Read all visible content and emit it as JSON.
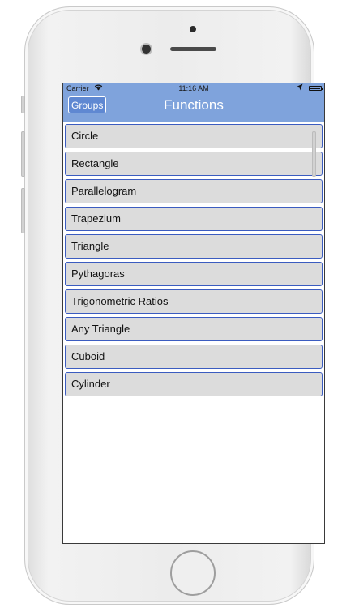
{
  "status_bar": {
    "carrier": "Carrier",
    "time": "11:16 AM",
    "wifi_icon": "wifi-icon",
    "location_icon": "location-arrow-icon",
    "battery_icon": "battery-icon"
  },
  "navbar": {
    "back_label": "Groups",
    "title": "Functions",
    "background_color": "#7fa3dc"
  },
  "functions": [
    {
      "label": "Circle"
    },
    {
      "label": "Rectangle"
    },
    {
      "label": "Parallelogram"
    },
    {
      "label": "Trapezium"
    },
    {
      "label": "Triangle"
    },
    {
      "label": "Pythagoras"
    },
    {
      "label": "Trigonometric Ratios"
    },
    {
      "label": "Any Triangle"
    },
    {
      "label": "Cuboid"
    },
    {
      "label": "Cylinder"
    }
  ]
}
